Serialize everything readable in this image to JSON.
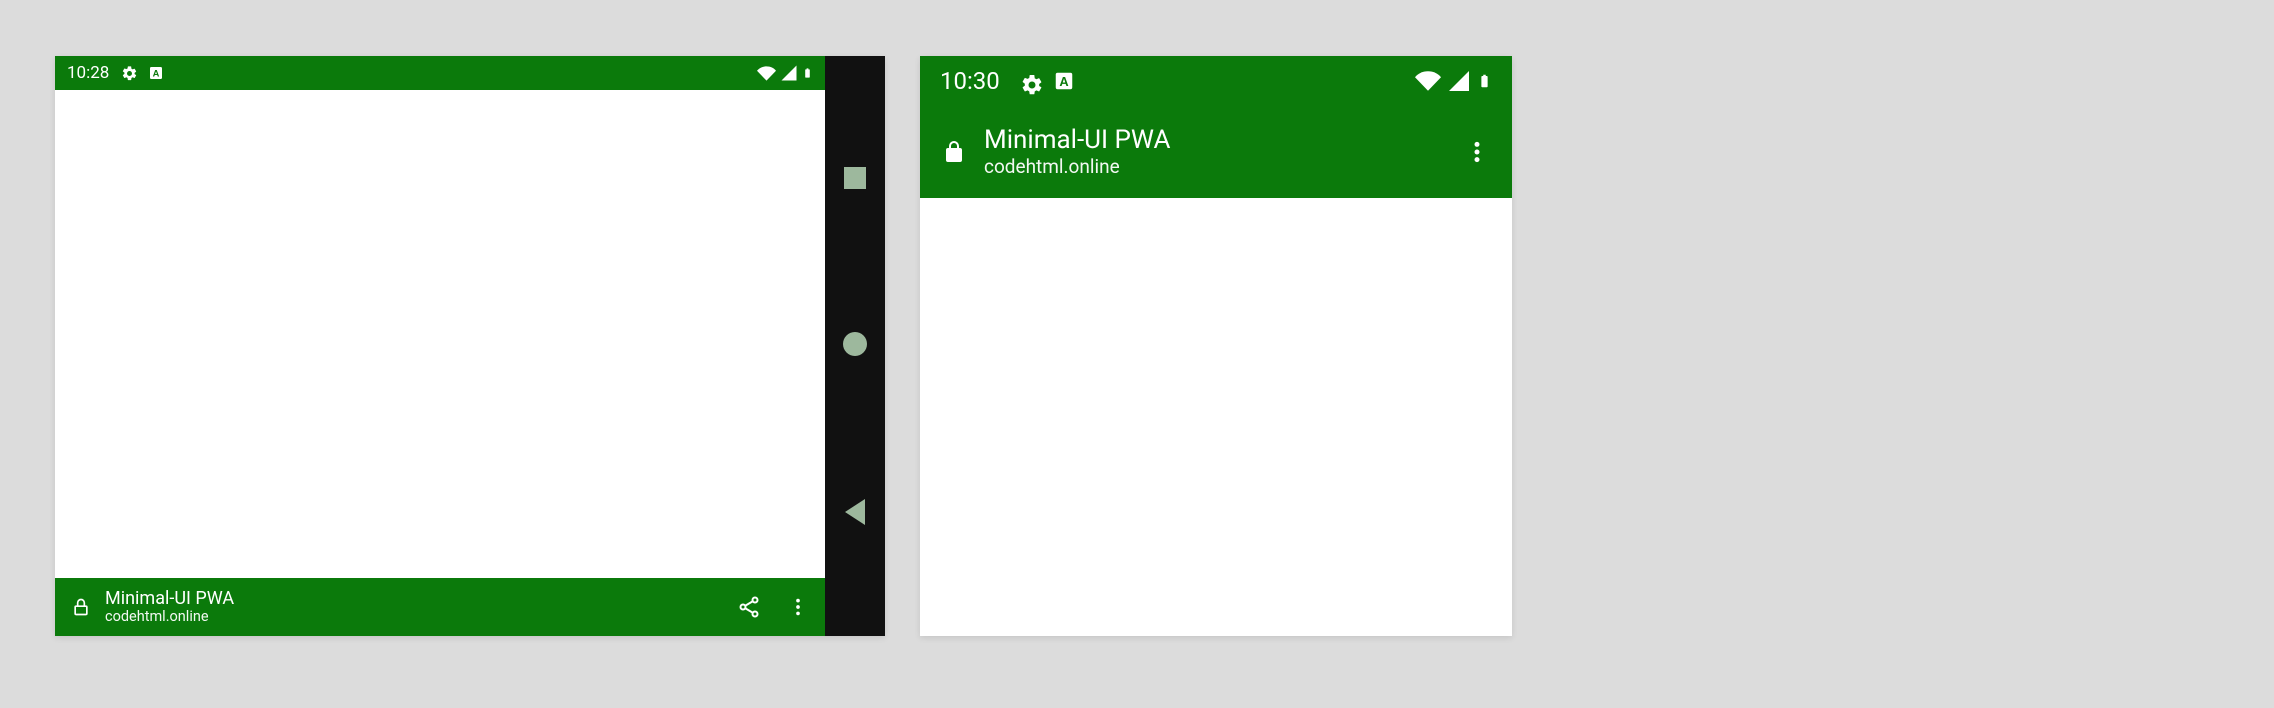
{
  "colors": {
    "theme": "#0b7a0b",
    "nav_bg": "#111111",
    "nav_fg": "#9db89d"
  },
  "left": {
    "statusbar": {
      "time": "10:28"
    },
    "app": {
      "title": "Minimal-UI PWA",
      "origin": "codehtml.online"
    },
    "bottom_actions": {
      "share_icon": "share-icon",
      "more_icon": "more-vert-icon"
    },
    "nav": {
      "recent_icon": "square-icon",
      "home_icon": "circle-icon",
      "back_icon": "triangle-left-icon"
    }
  },
  "right": {
    "statusbar": {
      "time": "10:30"
    },
    "app": {
      "title": "Minimal-UI PWA",
      "origin": "codehtml.online"
    },
    "appbar_actions": {
      "more_icon": "more-vert-icon"
    }
  }
}
